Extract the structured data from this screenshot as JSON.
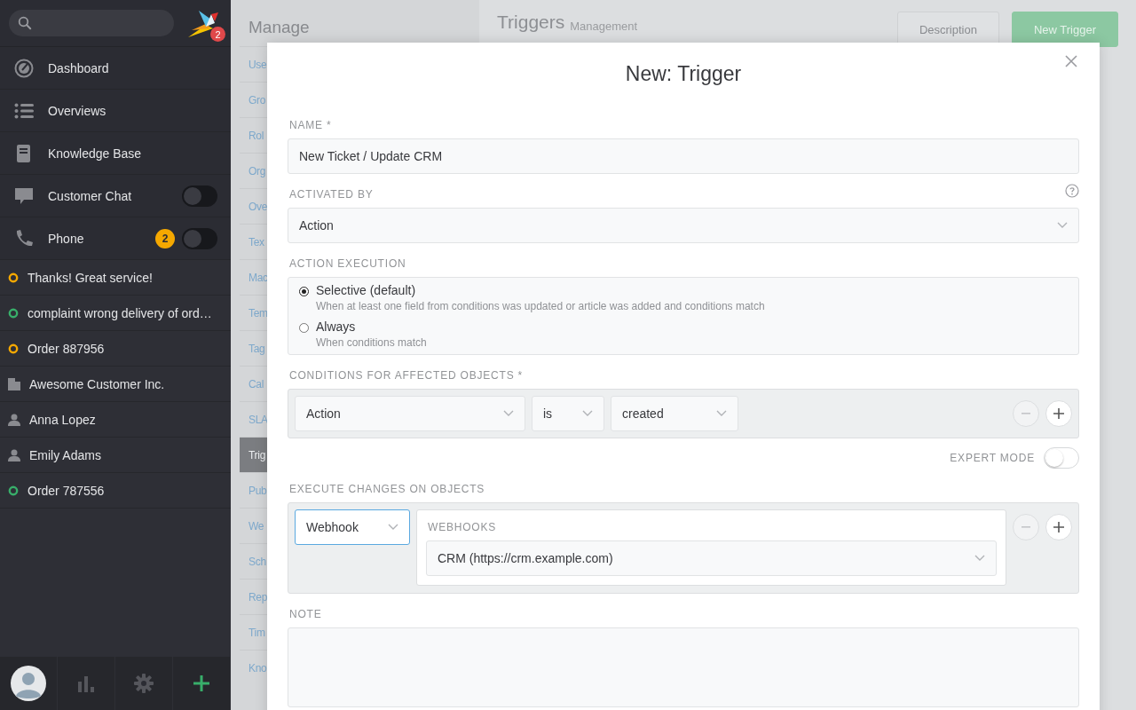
{
  "sidebar": {
    "logo_badge": "2",
    "nav": [
      {
        "label": "Dashboard",
        "kind": "dashboard"
      },
      {
        "label": "Overviews",
        "kind": "list"
      },
      {
        "label": "Knowledge Base",
        "kind": "book"
      },
      {
        "label": "Customer Chat",
        "kind": "chat",
        "toggle_on": false
      },
      {
        "label": "Phone",
        "kind": "phone",
        "badge": "2",
        "toggle_on": false
      }
    ],
    "recent": [
      {
        "label": "Thanks! Great service!",
        "kind": "ticket",
        "color": "#f5a800"
      },
      {
        "label": "complaint wrong delivery of ord…",
        "kind": "ticket",
        "color": "#38ae6a"
      },
      {
        "label": "Order 887956",
        "kind": "ticket",
        "color": "#f5a800"
      },
      {
        "label": "Awesome Customer Inc.",
        "kind": "organization"
      },
      {
        "label": "Anna Lopez",
        "kind": "user"
      },
      {
        "label": "Emily Adams",
        "kind": "user"
      },
      {
        "label": "Order 787556",
        "kind": "ticket",
        "color": "#38ae6a"
      }
    ]
  },
  "manage": {
    "title": "Manage",
    "links": [
      {
        "label": "Use",
        "selected": false
      },
      {
        "label": "Gro",
        "selected": false
      },
      {
        "label": "Rol",
        "selected": false
      },
      {
        "label": "Org",
        "selected": false
      },
      {
        "label": "Ove",
        "selected": false
      },
      {
        "label": "Tex",
        "selected": false
      },
      {
        "label": "Mac",
        "selected": false
      },
      {
        "label": "Tem",
        "selected": false
      },
      {
        "label": "Tag",
        "selected": false
      },
      {
        "label": "Cal",
        "selected": false
      },
      {
        "label": "SLA",
        "selected": false
      },
      {
        "label": "Trig",
        "selected": true
      },
      {
        "label": "Pub",
        "selected": false
      },
      {
        "label": "We",
        "selected": false
      },
      {
        "label": "Sch",
        "selected": false
      },
      {
        "label": "Rep",
        "selected": false
      },
      {
        "label": "Tim",
        "selected": false
      },
      {
        "label": "Kno",
        "selected": false
      }
    ]
  },
  "header": {
    "title": "Triggers",
    "subtitle": "Management",
    "buttons": [
      {
        "label": "Description",
        "kind": "secondary"
      },
      {
        "label": "New Trigger",
        "kind": "primary"
      }
    ]
  },
  "modal": {
    "title": "New: Trigger",
    "name": {
      "label": "NAME *",
      "value": "New Ticket / Update CRM"
    },
    "activated_by": {
      "label": "ACTIVATED BY",
      "value": "Action"
    },
    "action_execution": {
      "label": "ACTION EXECUTION",
      "options": [
        {
          "label": "Selective (default)",
          "description": "When at least one field from conditions was updated or article was added and conditions match",
          "selected": true
        },
        {
          "label": "Always",
          "description": "When conditions match",
          "selected": false
        }
      ]
    },
    "conditions": {
      "label": "CONDITIONS FOR AFFECTED OBJECTS *",
      "selects": [
        "Action",
        "is",
        "created"
      ],
      "remove_disabled": true
    },
    "expert_mode": {
      "label": "EXPERT MODE",
      "on": false
    },
    "changes": {
      "label": "EXECUTE CHANGES ON OBJECTS",
      "action": "Webhook",
      "action_focused": true,
      "webhooks_label": "WEBHOOKS",
      "webhook": "CRM (https://crm.example.com)",
      "remove_disabled": true
    },
    "note": {
      "label": "NOTE"
    }
  }
}
